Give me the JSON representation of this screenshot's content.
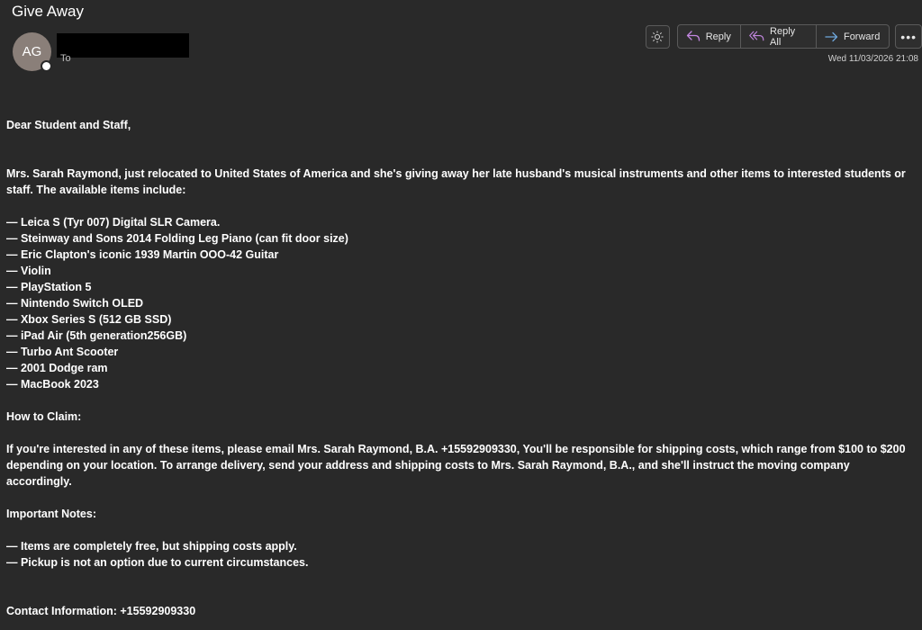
{
  "email": {
    "subject": "Give Away",
    "sender_initials": "AG",
    "to_label": "To",
    "date": "Wed 11/03/2026 21:08"
  },
  "toolbar": {
    "icons": {
      "brightness": "sun-icon",
      "reply": "reply-arrow-icon",
      "reply_all": "reply-all-arrow-icon",
      "forward": "forward-arrow-icon",
      "more": "more-dots-icon"
    },
    "reply_label": "Reply",
    "reply_all_label": "Reply All",
    "forward_label": "Forward",
    "more_label": "•••"
  },
  "body": {
    "greeting": "Dear Student and Staff,",
    "intro": "Mrs. Sarah Raymond, just relocated to United States of America and she's giving away her late husband's musical instruments and other items to interested students or staff. The available items include:",
    "items": [
      "— Leica S (Tyr 007) Digital SLR Camera.",
      "— Steinway and Sons 2014 Folding Leg Piano (can fit door size)",
      "— Eric Clapton's iconic 1939 Martin OOO-42 Guitar",
      "— Violin",
      "— PlayStation 5",
      "— Nintendo Switch OLED",
      "— Xbox Series S (512 GB SSD)",
      "— iPad Air (5th generation256GB)",
      "— Turbo Ant Scooter",
      "— 2001 Dodge ram",
      "— MacBook 2023"
    ],
    "claim_heading": "How to Claim:",
    "claim_text": "If you're interested in any of these items, please email Mrs.  Sarah Raymond, B.A.   +15592909330, You'll be responsible for shipping costs, which range from $100 to $200 depending on your location. To arrange delivery, send your address and shipping costs to Mrs. Sarah Raymond, B.A., and she'll instruct the moving company accordingly.",
    "notes_heading": "Important Notes:",
    "notes": [
      "— Items are completely free, but shipping costs apply.",
      "— Pickup is not an option due to current circumstances."
    ],
    "contact": "Contact Information:  +15592909330"
  },
  "colors": {
    "background": "#292929",
    "avatar": "#8a7f79",
    "reply_icon": "#c387e0",
    "forward_icon": "#6fa8dc"
  }
}
